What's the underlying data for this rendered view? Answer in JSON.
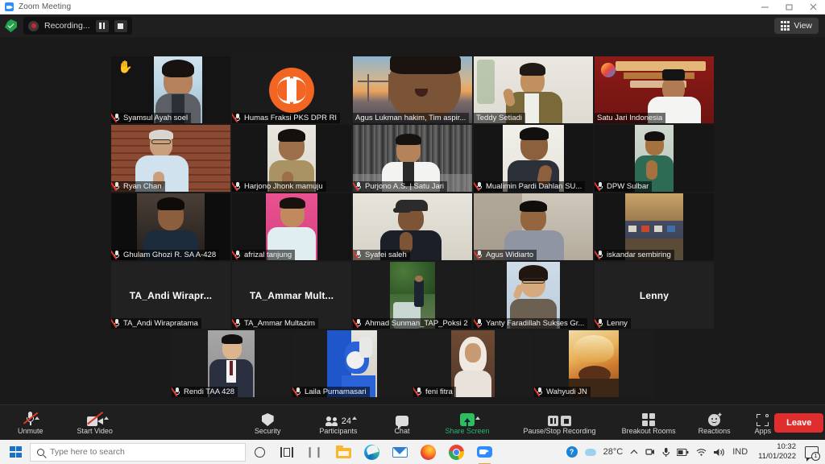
{
  "window": {
    "title": "Zoom Meeting",
    "app_icon": "zoom-icon",
    "minimize_label": "Minimize",
    "restore_label": "Restore",
    "close_label": "Close"
  },
  "recording_bar": {
    "shield_icon": "shield-check-icon",
    "record_icon": "record-dot-icon",
    "status_text": "Recording...",
    "pause_label": "Pause Recording",
    "stop_label": "Stop Recording",
    "view_label": "View",
    "view_icon": "grid-icon"
  },
  "gallery": {
    "rows": [
      [
        {
          "name": "Syamsul Ayah soel",
          "muted": true,
          "hand_raised": true,
          "type": "video",
          "style": "portrait-indoor"
        },
        {
          "name": "Humas Fraksi PKS DPR RI",
          "muted": true,
          "type": "logo",
          "style": "pks-logo"
        },
        {
          "name": "Agus Lukman hakim, Tim aspir...",
          "muted": false,
          "type": "video",
          "style": "bridge-sunset",
          "active_speaker": true
        },
        {
          "name": "Teddy Setiadi",
          "muted": false,
          "type": "video",
          "style": "batik-room"
        },
        {
          "name": "Satu Jari Indonesia",
          "muted": false,
          "type": "video",
          "style": "red-banner"
        }
      ],
      [
        {
          "name": "Ryan Chan",
          "muted": true,
          "type": "video",
          "style": "brick-wall"
        },
        {
          "name": "Harjono Jhonk mamuju",
          "muted": true,
          "type": "video",
          "style": "khaki-shirt"
        },
        {
          "name": "Purjono A.S. | Satu Jari",
          "muted": true,
          "type": "video",
          "style": "city-bw"
        },
        {
          "name": "Mualimin Pardi Dahlan SU...",
          "muted": true,
          "type": "video",
          "style": "plain-wall"
        },
        {
          "name": "DPW Sulbar",
          "muted": true,
          "type": "video",
          "style": "teal-shirt"
        }
      ],
      [
        {
          "name": "Ghulam Ghozi R. SA A-428",
          "muted": true,
          "type": "video",
          "style": "dark-room"
        },
        {
          "name": "afrizal tanjung",
          "muted": true,
          "type": "video",
          "style": "pink-bg"
        },
        {
          "name": "Syafei saleh",
          "muted": true,
          "type": "video",
          "style": "cap-man"
        },
        {
          "name": "Agus Widiarto",
          "muted": true,
          "type": "video",
          "style": "office-desk"
        },
        {
          "name": "iskandar sembiring",
          "muted": true,
          "type": "video",
          "style": "hall-crowd"
        }
      ],
      [
        {
          "name": "TA_Andi Wirapratama",
          "initials": "TA_Andi  Wirapr...",
          "muted": true,
          "type": "text"
        },
        {
          "name": "TA_Ammar Multazim",
          "initials": "TA_Ammar  Mult...",
          "muted": true,
          "type": "text"
        },
        {
          "name": "Ahmad Sunman_TAP_Poksi 2",
          "muted": true,
          "type": "photo",
          "style": "waterfall-forest"
        },
        {
          "name": "Yanty Faradillah Sukses Gr...",
          "muted": true,
          "type": "photo",
          "style": "glasses-woman"
        },
        {
          "name": "Lenny",
          "initials": "Lenny",
          "muted": true,
          "type": "text"
        }
      ],
      [
        {
          "name": "Rendi TAA 428",
          "muted": true,
          "type": "photo",
          "style": "suit-man"
        },
        {
          "name": "Laila Purnamasari",
          "muted": true,
          "type": "photo",
          "style": "ppe-blue"
        },
        {
          "name": "feni fitra",
          "muted": true,
          "type": "photo",
          "style": "hijab-woman"
        },
        {
          "name": "Wahyudi JN",
          "muted": true,
          "type": "photo",
          "style": "bird-paradise"
        }
      ]
    ]
  },
  "controls": {
    "unmute": {
      "label": "Unmute",
      "icon": "mic-muted-icon",
      "has_caret": true
    },
    "start_video": {
      "label": "Start Video",
      "icon": "camera-muted-icon",
      "has_caret": true
    },
    "security": {
      "label": "Security",
      "icon": "shield-icon"
    },
    "participants": {
      "label": "Participants",
      "icon": "people-icon",
      "count": "24",
      "has_caret": true
    },
    "chat": {
      "label": "Chat",
      "icon": "chat-bubble-icon"
    },
    "share_screen": {
      "label": "Share Screen",
      "icon": "share-screen-icon",
      "has_caret": true,
      "color": "#29b473"
    },
    "recording": {
      "label": "Pause/Stop Recording",
      "pause_icon": "pause-icon",
      "stop_icon": "stop-icon"
    },
    "breakout": {
      "label": "Breakout Rooms",
      "icon": "breakout-grid-icon"
    },
    "reactions": {
      "label": "Reactions",
      "icon": "reactions-smiley-icon"
    },
    "apps": {
      "label": "Apps",
      "icon": "apps-icon"
    },
    "leave": {
      "label": "Leave",
      "color": "#e02d2d"
    }
  },
  "taskbar": {
    "start_icon": "windows-start-icon",
    "search_placeholder": "Type here to search",
    "search_value": "",
    "cortana_icon": "cortana-circle-icon",
    "taskview_icon": "task-view-icon",
    "apps": [
      {
        "name": "file-explorer-icon",
        "label": "File Explorer"
      },
      {
        "name": "microsoft-edge-icon",
        "label": "Microsoft Edge"
      },
      {
        "name": "mail-icon",
        "label": "Mail"
      },
      {
        "name": "firefox-icon",
        "label": "Firefox"
      },
      {
        "name": "chrome-icon",
        "label": "Google Chrome"
      },
      {
        "name": "zoom-taskbar-icon",
        "label": "Zoom",
        "active": true
      }
    ],
    "tray": {
      "help_icon": "help-question-icon",
      "weather_icon": "weather-cloud-icon",
      "temperature": "28°C",
      "chevron_icon": "show-hidden-icons-chevron",
      "camera_icon": "camera-in-use-icon",
      "mic_icon": "microphone-in-use-icon",
      "battery_icon": "battery-icon",
      "wifi_icon": "wifi-icon",
      "volume_icon": "volume-icon",
      "language": "IND",
      "time": "10:32",
      "date": "11/01/2022",
      "notification_icon": "notification-center-icon",
      "notification_count": "1"
    }
  }
}
